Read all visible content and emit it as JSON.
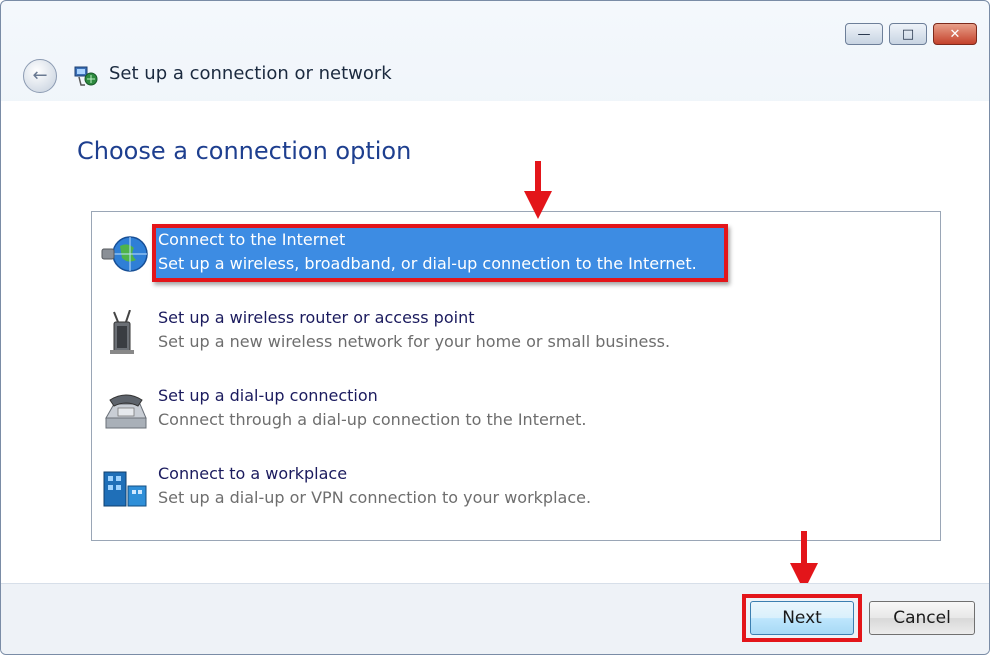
{
  "window": {
    "title": "Set up a connection or network",
    "caption_buttons": [
      {
        "name": "minimize-button",
        "glyph": "—"
      },
      {
        "name": "maximize-button",
        "glyph": "□"
      },
      {
        "name": "close-button",
        "glyph": "✕"
      }
    ]
  },
  "page": {
    "heading": "Choose a connection option"
  },
  "options": [
    {
      "title": "Connect to the Internet",
      "description": "Set up a wireless, broadband, or dial-up connection to the Internet.",
      "icon": "globe-icon",
      "selected": true
    },
    {
      "title": "Set up a wireless router or access point",
      "description": "Set up a new wireless network for your home or small business.",
      "icon": "wireless-router-icon",
      "selected": false
    },
    {
      "title": "Set up a dial-up connection",
      "description": "Connect through a dial-up connection to the Internet.",
      "icon": "telephone-modem-icon",
      "selected": false
    },
    {
      "title": "Connect to a workplace",
      "description": "Set up a dial-up or VPN connection to your workplace.",
      "icon": "workplace-icon",
      "selected": false
    }
  ],
  "footer": {
    "next_label": "Next",
    "cancel_label": "Cancel"
  },
  "annotations": {
    "highlight_color": "#e3151a",
    "selection_color": "#3d8ce3"
  }
}
